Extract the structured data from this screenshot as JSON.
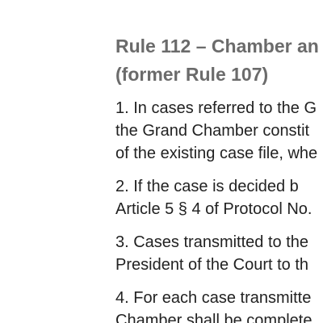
{
  "document": {
    "top_fragment": "",
    "heading": {
      "line1": "Rule 112 – Chamber an",
      "line2": "(former Rule 107)"
    },
    "paragraphs": [
      {
        "lines": [
          "1.  In cases referred to the G",
          "the Grand Chamber constit",
          "of the existing case file, whe"
        ]
      },
      {
        "lines": [
          "2.  If  the  case  is  decided  b",
          "Article 5 § 4 of Protocol No."
        ]
      },
      {
        "lines": [
          "3.  Cases  transmitted  to  the",
          "President of the Court to th"
        ]
      },
      {
        "lines": [
          "4.  For each case transmitte",
          "Chamber shall be complete"
        ]
      }
    ]
  }
}
